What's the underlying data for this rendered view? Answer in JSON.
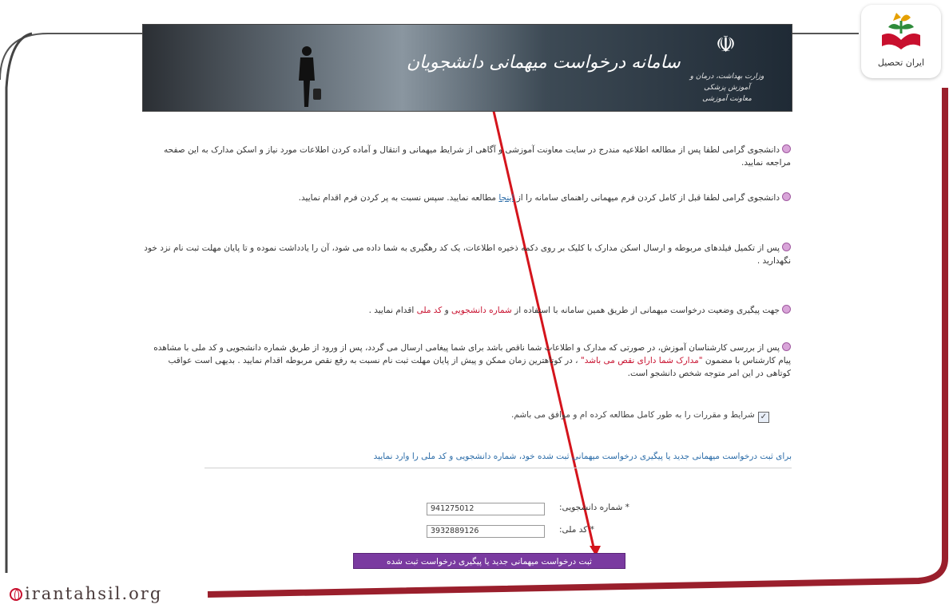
{
  "banner": {
    "title": "سامانه درخواست میهمانی دانشجویان",
    "ministry_line1": "وزارت بهداشت، درمان و آموزش پزشکی",
    "ministry_line2": "معاونت آموزشی"
  },
  "instructions": [
    {
      "text": "دانشجوی گرامی لطفا پس از مطالعه اطلاعیه مندرج در سایت معاونت آموزشی و آگاهی از شرایط میهمانی و انتقال و آماده کردن اطلاعات مورد نیاز و اسکن مدارک به این صفحه مراجعه نمایید."
    },
    {
      "text_before": "دانشجوی گرامی لطفا قبل از کامل کردن فرم میهمانی راهنمای سامانه را از ",
      "link": "اینجا",
      "text_after": " مطالعه نمایید. سپس نسبت به پر کردن فرم اقدام نمایید."
    },
    {
      "text": "پس از تکمیل فیلدهای مربوطه و ارسال اسکن مدارک با کلیک بر روی دکمه ذخیره اطلاعات، یک کد رهگیری به شما داده می شود، آن را یادداشت نموده و تا پایان مهلت ثبت نام نزد خود نگهدارید ."
    },
    {
      "text_before": "جهت پیگیری وضعیت درخواست میهمانی از طریق همین سامانه با استفاده از ",
      "red1": "شماره دانشجویی",
      "mid": " و ",
      "red2": "کد ملی",
      "text_after": " اقدام نمایید ."
    },
    {
      "text_before": "پس از بررسی کارشناسان آموزش، در صورتی که مدارک و اطلاعات شما ناقص باشد برای شما پیغامی ارسال می گردد، پس از ورود از طریق شماره دانشجویی و کد ملی با مشاهده پیام کارشناس با مضمون ",
      "red": "\"مدارک شما دارای نقص می باشد\"",
      "text_after": " ، در کوتاهترین زمان ممکن و پیش از پایان مهلت ثبت نام نسبت به رفع نقص مربوطه اقدام نمایید . بدیهی است عواقب کوتاهی در این امر متوجه شخص دانشجو است."
    }
  ],
  "agreement": {
    "label": "شرایط و مقررات را به طور کامل مطالعه کرده ام و موافق می باشم.",
    "checked": "✓"
  },
  "info_text": "برای ثبت درخواست میهمانی جدید یا پیگیری درخواست میهمانی ثبت شده خود، شماره دانشجویی و کد ملی را وارد نمایید",
  "form": {
    "student_number_label": "* شماره دانشجویی:",
    "student_number_value": "941275012",
    "national_code_label": "* کد ملی:",
    "national_code_value": "3932889126",
    "submit_label": "ثبت درخواست میهمانی جدید یا پیگیری درخواست ثبت شده"
  },
  "watermark": {
    "logo_text": "ایران تحصیل",
    "site": "irantahsil.org"
  },
  "colors": {
    "accent_red": "#c8102e",
    "button_purple": "#7a3aa0",
    "frame_red": "#b01a2a"
  }
}
